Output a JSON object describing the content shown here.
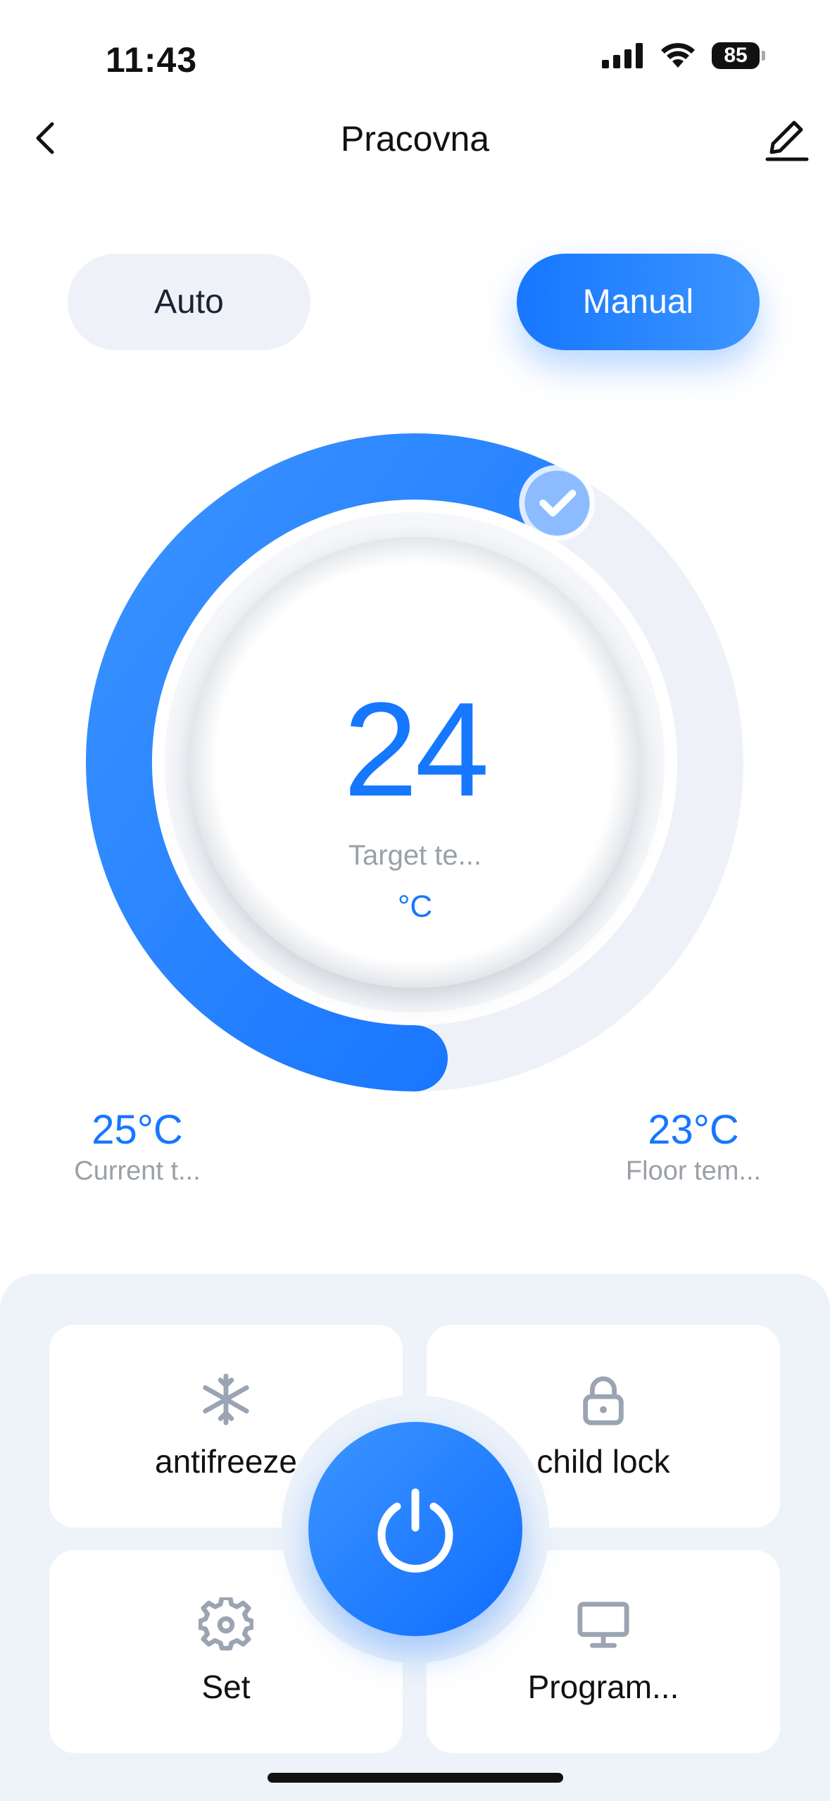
{
  "status_bar": {
    "time": "11:43",
    "battery": "85"
  },
  "nav": {
    "title": "Pracovna"
  },
  "modes": {
    "auto": "Auto",
    "manual": "Manual",
    "selected": "Manual"
  },
  "dial": {
    "target_value": "24",
    "target_label": "Target te...",
    "unit": "°C",
    "progress": 0.58
  },
  "readings": {
    "current_value": "25°C",
    "current_label": "Current t...",
    "floor_value": "23°C",
    "floor_label": "Floor tem..."
  },
  "controls": {
    "antifreeze": {
      "label": "antifreeze",
      "icon": "snowflake-icon"
    },
    "child_lock": {
      "label": "child lock",
      "icon": "lock-icon"
    },
    "set": {
      "label": "Set",
      "icon": "gear-icon"
    },
    "program": {
      "label": "Program...",
      "icon": "monitor-icon"
    },
    "power": {
      "icon": "power-icon"
    }
  },
  "colors": {
    "accent": "#1677ff",
    "track": "#eef2f8",
    "panel": "#eef3fa"
  }
}
